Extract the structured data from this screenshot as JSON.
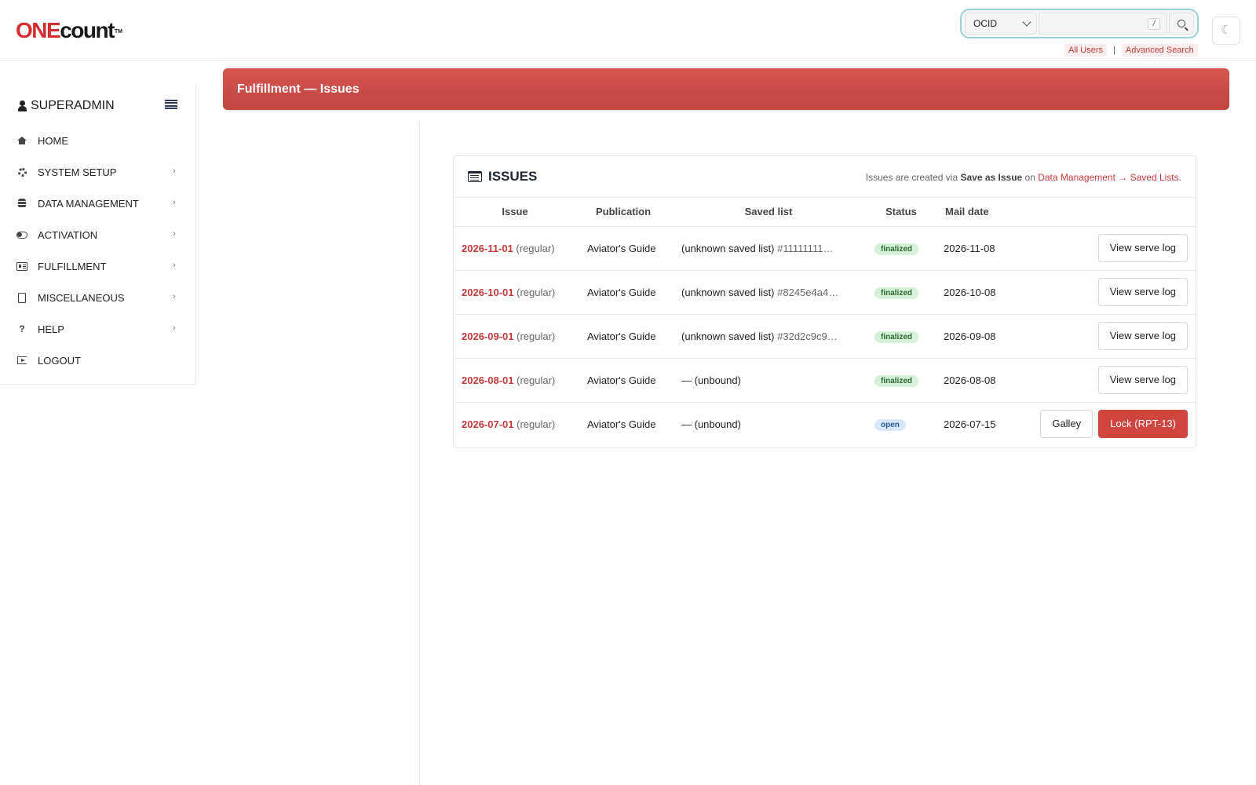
{
  "header": {
    "logo": {
      "one": "ONE",
      "count": "count",
      "tm": "TM"
    },
    "search": {
      "select_value": "OCID",
      "placeholder": "",
      "shortcut": "/"
    },
    "links": {
      "all_users": "All Users",
      "separator": "|",
      "advanced_search": "Advanced Search"
    },
    "theme_icon": "☾"
  },
  "sidebar": {
    "user": "SUPERADMIN",
    "items": [
      {
        "label": "HOME",
        "icon": "home-icon",
        "has_arrow": false
      },
      {
        "label": "SYSTEM SETUP",
        "icon": "gear-icon",
        "has_arrow": true
      },
      {
        "label": "DATA MANAGEMENT",
        "icon": "database-icon",
        "has_arrow": true
      },
      {
        "label": "ACTIVATION",
        "icon": "toggle-icon",
        "has_arrow": true
      },
      {
        "label": "FULFILLMENT",
        "icon": "newspaper-icon",
        "has_arrow": true
      },
      {
        "label": "MISCELLANEOUS",
        "icon": "file-icon",
        "has_arrow": true
      },
      {
        "label": "HELP",
        "icon": "question-icon",
        "has_arrow": true
      },
      {
        "label": "LOGOUT",
        "icon": "logout-icon",
        "has_arrow": false
      }
    ],
    "arrow": "›"
  },
  "page": {
    "title": "Fulfillment — Issues"
  },
  "issues": {
    "title": "ISSUES",
    "note": {
      "prefix": "Issues are created via ",
      "action": "Save as Issue",
      "middle": " on ",
      "link": "Data Management → Saved Lists",
      "suffix": "."
    },
    "columns": [
      "Issue",
      "Publication",
      "Saved list",
      "Status",
      "Mail date"
    ],
    "rows": [
      {
        "date": "2026-11-01",
        "kind": "(regular)",
        "publication": "Aviator's Guide",
        "saved_list": "(unknown saved list)",
        "hash": "#11111111…",
        "status": "finalized",
        "mail_date": "2026-11-08",
        "actions": [
          "View serve log"
        ]
      },
      {
        "date": "2026-10-01",
        "kind": "(regular)",
        "publication": "Aviator's Guide",
        "saved_list": "(unknown saved list)",
        "hash": "#8245e4a4…",
        "status": "finalized",
        "mail_date": "2026-10-08",
        "actions": [
          "View serve log"
        ]
      },
      {
        "date": "2026-09-01",
        "kind": "(regular)",
        "publication": "Aviator's Guide",
        "saved_list": "(unknown saved list)",
        "hash": "#32d2c9c9…",
        "status": "finalized",
        "mail_date": "2026-09-08",
        "actions": [
          "View serve log"
        ]
      },
      {
        "date": "2026-08-01",
        "kind": "(regular)",
        "publication": "Aviator's Guide",
        "saved_list": "— (unbound)",
        "hash": "",
        "status": "finalized",
        "mail_date": "2026-08-08",
        "actions": [
          "View serve log"
        ]
      },
      {
        "date": "2026-07-01",
        "kind": "(regular)",
        "publication": "Aviator's Guide",
        "saved_list": "— (unbound)",
        "hash": "",
        "status": "open",
        "mail_date": "2026-07-15",
        "actions": [
          "Galley",
          "Lock (RPT-13)"
        ]
      }
    ]
  },
  "colors": {
    "accent": "#c73a3a",
    "header_bar": "#c9504a",
    "finalized_bg": "#d6f0d9",
    "open_bg": "#d8e8fa"
  }
}
